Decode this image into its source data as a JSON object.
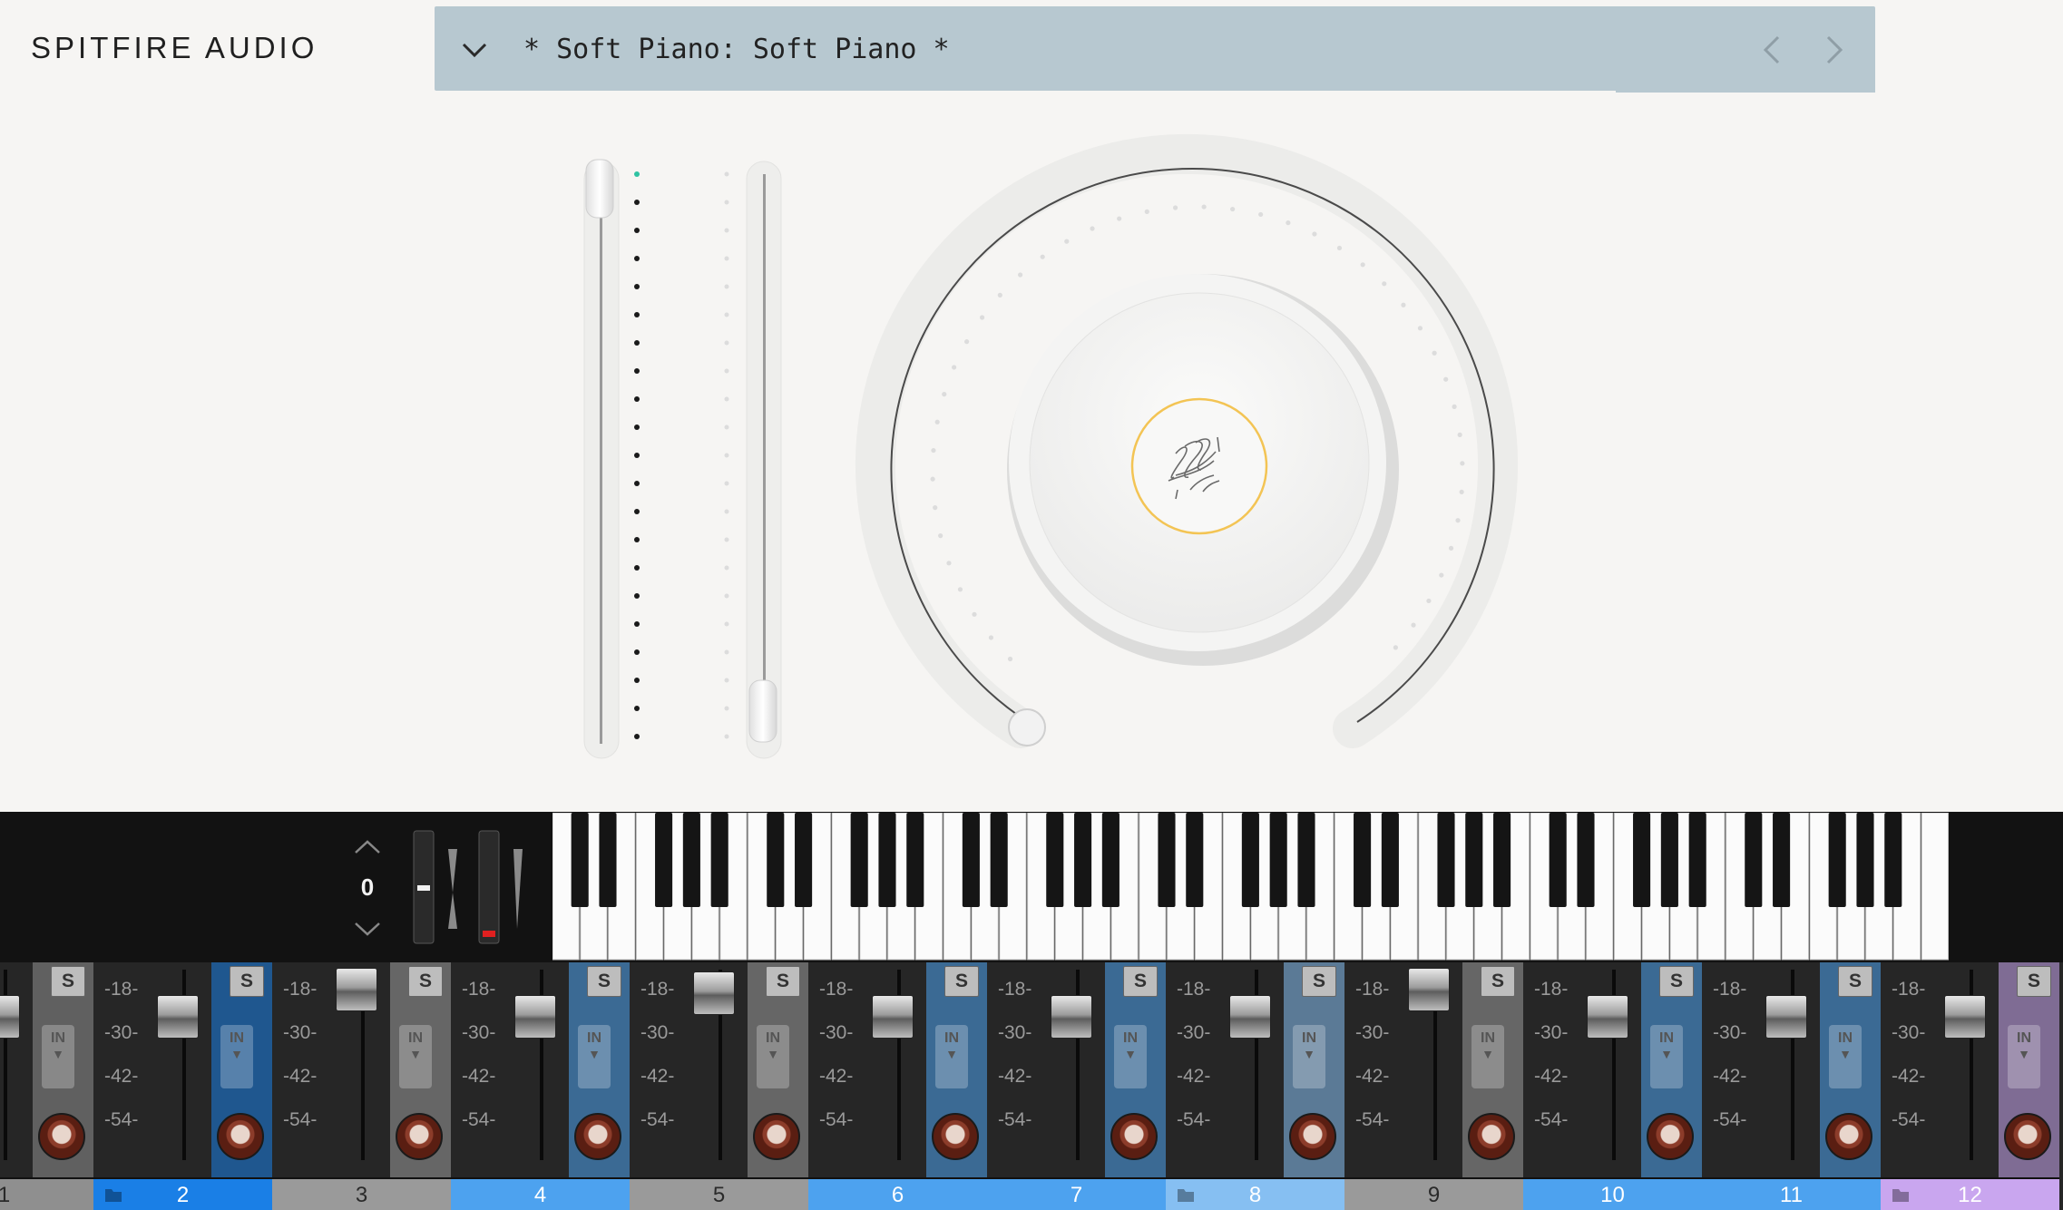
{
  "header": {
    "brand": "SPITFIRE AUDIO",
    "preset_title": "* Soft Piano: Soft Piano *"
  },
  "keyboard": {
    "transpose_value": "0",
    "white_key_count": 50
  },
  "mixer": {
    "meter_labels": [
      "-18-",
      "-30-",
      "-42-",
      "-54-"
    ],
    "solo_label": "S",
    "input_label": "IN",
    "channels": [
      {
        "label": "1",
        "color": "#8f8f8f",
        "fader": 0.42,
        "folder": false
      },
      {
        "label": "2",
        "color": "#1a7fe6",
        "fader": 0.42,
        "folder": true
      },
      {
        "label": "3",
        "color": "#9a9a9a",
        "fader": 0.05,
        "folder": false
      },
      {
        "label": "4",
        "color": "#4da2ef",
        "fader": 0.42,
        "folder": false
      },
      {
        "label": "5",
        "color": "#9a9a9a",
        "fader": 0.1,
        "folder": false
      },
      {
        "label": "6",
        "color": "#4da2ef",
        "fader": 0.42,
        "folder": false
      },
      {
        "label": "7",
        "color": "#4da2ef",
        "fader": 0.42,
        "folder": false
      },
      {
        "label": "8",
        "color": "#86bff2",
        "fader": 0.42,
        "folder": true
      },
      {
        "label": "9",
        "color": "#9a9a9a",
        "fader": 0.05,
        "folder": false
      },
      {
        "label": "10",
        "color": "#4da2ef",
        "fader": 0.42,
        "folder": false
      },
      {
        "label": "11",
        "color": "#4da2ef",
        "fader": 0.42,
        "folder": false
      },
      {
        "label": "12",
        "color": "#c9a6ef",
        "fader": 0.42,
        "folder": true
      }
    ]
  },
  "colors": {
    "preset_bar": "#b7c8d0",
    "accent_dot": "#2ec2a2",
    "logo_ring": "#f3c454"
  }
}
